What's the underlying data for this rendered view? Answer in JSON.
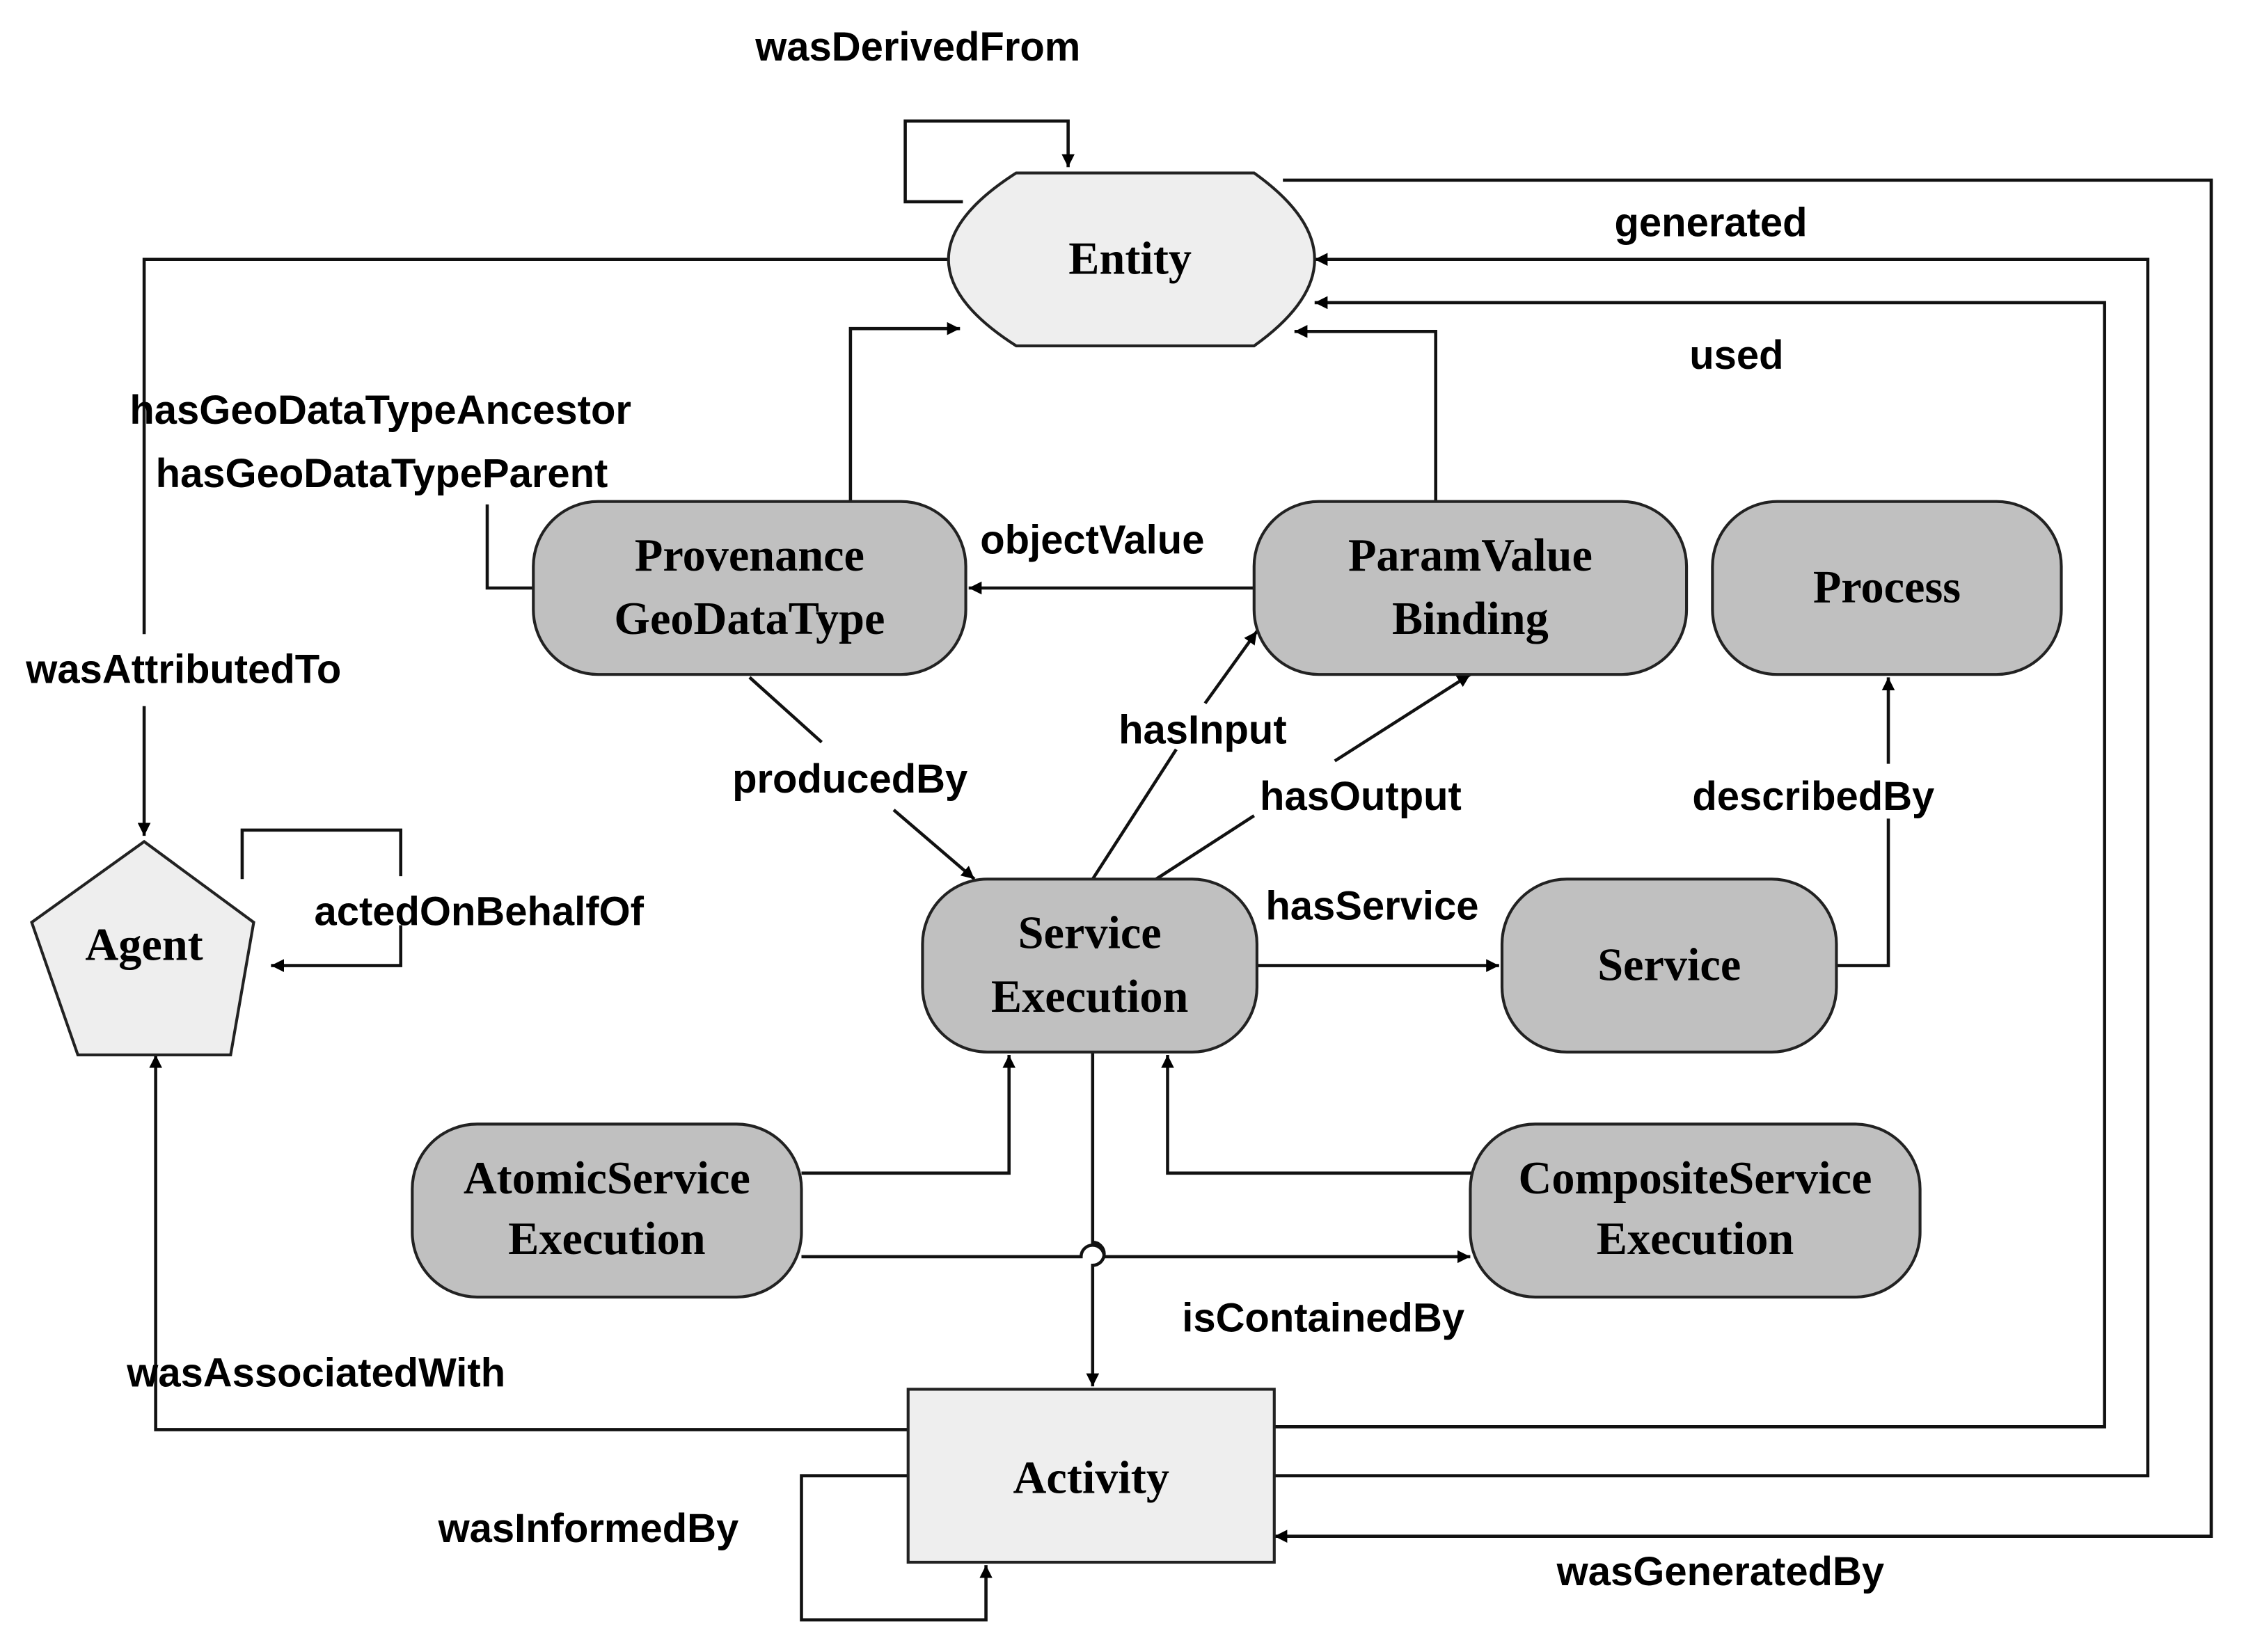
{
  "nodes": {
    "entity": {
      "label": "Entity",
      "fill": "#eeeeee"
    },
    "agent": {
      "label": "Agent",
      "fill": "#eeeeee"
    },
    "activity": {
      "label": "Activity",
      "fill": "#eeeeee"
    },
    "provenance_geodatatype": {
      "line1": "Provenance",
      "line2": "GeoDataType",
      "fill": "#c0c0c0"
    },
    "param_value_binding": {
      "line1": "ParamValue",
      "line2": "Binding",
      "fill": "#c0c0c0"
    },
    "process": {
      "label": "Process",
      "fill": "#c0c0c0"
    },
    "service_execution": {
      "line1": "Service",
      "line2": "Execution",
      "fill": "#c0c0c0"
    },
    "service": {
      "label": "Service",
      "fill": "#c0c0c0"
    },
    "atomic_service_execution": {
      "line1": "AtomicService",
      "line2": "Execution",
      "fill": "#c0c0c0"
    },
    "composite_service_execution": {
      "line1": "CompositeService",
      "line2": "Execution",
      "fill": "#c0c0c0"
    }
  },
  "edges": {
    "was_derived_from": "wasDerivedFrom",
    "generated": "generated",
    "used": "used",
    "has_geo_data_type_ancestor": "hasGeoDataTypeAncestor",
    "has_geo_data_type_parent": "hasGeoDataTypeParent",
    "object_value": "objectValue",
    "was_attributed_to": "wasAttributedTo",
    "has_input": "hasInput",
    "produced_by": "producedBy",
    "has_output": "hasOutput",
    "described_by": "describedBy",
    "acted_on_behalf_of": "actedOnBehalfOf",
    "has_service": "hasService",
    "is_contained_by": "isContainedBy",
    "was_associated_with": "wasAssociatedWith",
    "was_informed_by": "wasInformedBy",
    "was_generated_by": "wasGeneratedBy"
  }
}
